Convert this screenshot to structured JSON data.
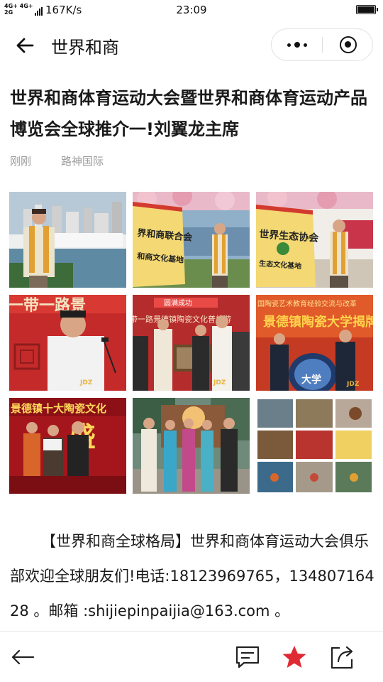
{
  "status_bar": {
    "network_top": "4G+ 4G+",
    "network_bottom": "2G",
    "speed": "167K/s",
    "time": "23:09"
  },
  "nav": {
    "title": "世界和商"
  },
  "article": {
    "title": "世界和商体育运动大会暨世界和商体育运动产品博览会全球推介一!刘翼龙主席",
    "time": "刚刚",
    "source": "路神国际",
    "body": "【世界和商全球格局】世界和商体育运动大会俱乐部欢迎全球朋友们!电话:18123969765，13480716428 。邮箱 :shijiepinpaijia@163.com 。"
  },
  "images": {
    "sign_1": "界和商联合会",
    "sign_1b": "和商文化基地",
    "sign_2": "世界生态协会",
    "sign_2b": "生态文化基地",
    "banner_3": "一带一路景",
    "banner_5": "圆满成功",
    "banner_5b": "带一路景德镇陶瓷文化普旅游",
    "banner_6": "国陶瓷艺术教育经验交流与改革",
    "banner_6b": "景德镇陶瓷大学揭牌",
    "banner_6c": "大学",
    "banner_7": "景德镇十大陶瓷文化",
    "banner_7b": "盛",
    "watermark_3": "JDZ",
    "watermark_5": "JDZ",
    "watermark_6": "JDZ"
  },
  "colors": {
    "star": "#e02a33",
    "text": "#1a1a1a",
    "meta": "#9a9a9a"
  },
  "icons": {
    "nav_back": "arrow-left-icon",
    "more": "more-dots-icon",
    "close": "target-close-icon",
    "bottom_back": "arrow-left-icon",
    "comment": "comment-icon",
    "favorite": "star-icon",
    "share": "share-icon"
  }
}
